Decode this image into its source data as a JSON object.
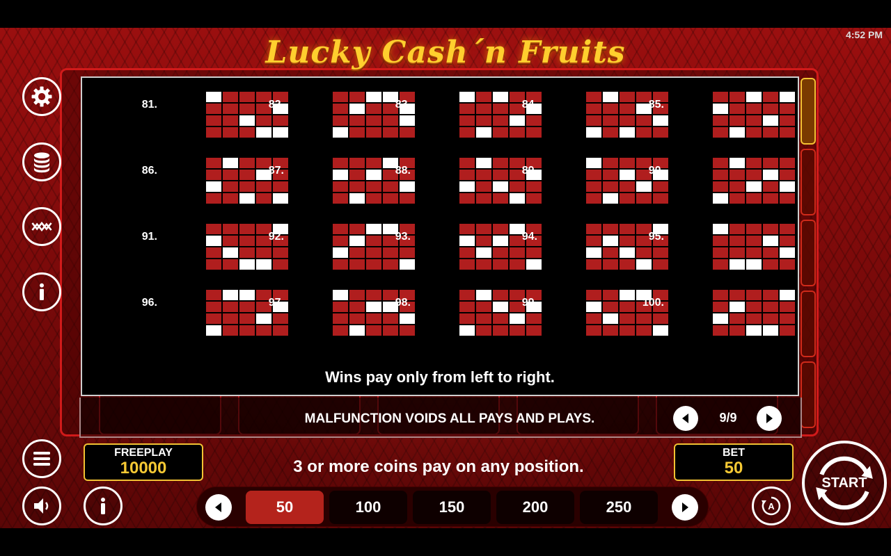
{
  "status_bar": {
    "time": "4:52 PM"
  },
  "game": {
    "title": "Lucky Cash´n Fruits"
  },
  "side_menu": {
    "icons": [
      "gear-icon",
      "coins-stack-icon",
      "paylines-icon",
      "info-icon"
    ]
  },
  "paylines": {
    "lines": [
      {
        "number": "81.",
        "rows": [
          "10000",
          "00001",
          "00100",
          "00011"
        ]
      },
      {
        "number": "82.",
        "rows": [
          "00110",
          "01001",
          "00001",
          "10000"
        ]
      },
      {
        "number": "83.",
        "rows": [
          "10100",
          "00001",
          "00010",
          "01000"
        ]
      },
      {
        "number": "84.",
        "rows": [
          "01000",
          "00010",
          "00001",
          "10100"
        ]
      },
      {
        "number": "85.",
        "rows": [
          "00101",
          "10000",
          "00010",
          "01000"
        ]
      },
      {
        "number": "86.",
        "rows": [
          "01000",
          "00010",
          "10000",
          "00101"
        ]
      },
      {
        "number": "87.",
        "rows": [
          "00010",
          "10100",
          "00001",
          "01000"
        ]
      },
      {
        "number": "88.",
        "rows": [
          "01000",
          "00001",
          "10100",
          "00010"
        ]
      },
      {
        "number": "89.",
        "rows": [
          "10000",
          "00101",
          "00010",
          "01000"
        ]
      },
      {
        "number": "90.",
        "rows": [
          "01000",
          "00010",
          "00101",
          "10000"
        ]
      },
      {
        "number": "91.",
        "rows": [
          "00001",
          "10000",
          "01000",
          "00110"
        ]
      },
      {
        "number": "92.",
        "rows": [
          "00110",
          "01000",
          "10000",
          "00001"
        ]
      },
      {
        "number": "93.",
        "rows": [
          "00010",
          "10100",
          "01000",
          "00001"
        ]
      },
      {
        "number": "94.",
        "rows": [
          "00001",
          "01000",
          "10100",
          "00010"
        ]
      },
      {
        "number": "95.",
        "rows": [
          "10000",
          "00010",
          "00001",
          "01100"
        ]
      },
      {
        "number": "96.",
        "rows": [
          "01100",
          "00001",
          "00010",
          "10000"
        ]
      },
      {
        "number": "97.",
        "rows": [
          "10000",
          "00110",
          "00001",
          "01000"
        ]
      },
      {
        "number": "98.",
        "rows": [
          "01000",
          "00101",
          "00010",
          "10000"
        ]
      },
      {
        "number": "99.",
        "rows": [
          "00110",
          "10000",
          "01000",
          "00001"
        ]
      },
      {
        "number": "100.",
        "rows": [
          "00001",
          "01000",
          "10000",
          "00110"
        ]
      }
    ],
    "note": "Wins pay only from left to right."
  },
  "lower_panel": {
    "malfunction": "MALFUNCTION VOIDS ALL PAYS AND PLAYS.",
    "page_indicator": "9/9"
  },
  "bottom_bar": {
    "freeplay_label": "FREEPLAY",
    "freeplay_value": "10000",
    "coins_message": "3 or more coins pay on any position.",
    "bet_label": "BET",
    "bet_value": "50",
    "bet_options": [
      "50",
      "100",
      "150",
      "200",
      "250"
    ],
    "selected_bet": "50",
    "start_label": "START"
  },
  "colors": {
    "accent_gold": "#f6c934",
    "payline_cell": "#b01e1e",
    "payline_active": "#ffffff",
    "selected_bet": "#b4231c"
  }
}
